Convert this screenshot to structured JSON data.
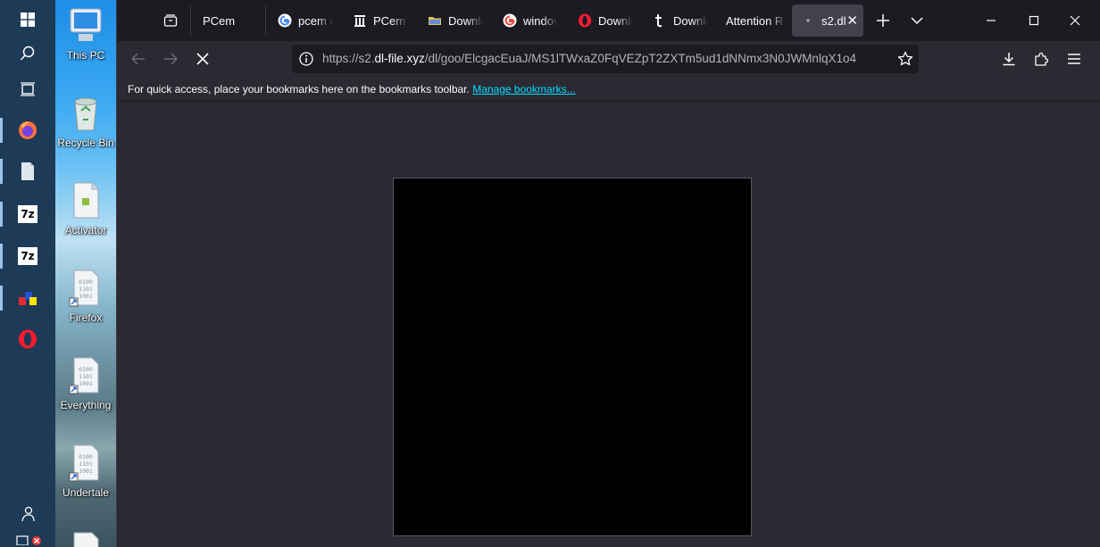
{
  "browser": {
    "tabs": [
      {
        "label": "PCem",
        "icon": "firefox-view-icon"
      },
      {
        "label": "pcem r",
        "icon": "google-icon"
      },
      {
        "label": "PCem \\",
        "icon": "library-icon"
      },
      {
        "label": "Downlc",
        "icon": "folder-icon"
      },
      {
        "label": "windov",
        "icon": "google-icon"
      },
      {
        "label": "Downlc",
        "icon": "opera-icon"
      },
      {
        "label": "Downlc",
        "icon": "t-icon"
      },
      {
        "label": "Attention R",
        "icon": ""
      },
      {
        "label": "s2.dl",
        "icon": "loading-icon",
        "selected": true
      }
    ],
    "url": {
      "prefix": "https://s2.",
      "host": "dl-file.xyz",
      "path": "/dl/goo/ElcgacEuaJ/MS1lTWxaZ0FqVEZpT2ZXTm5ud1dNNmx3N0JWMnlqX1o4"
    },
    "bookmarks_toolbar": {
      "message": "For quick access, place your bookmarks here on the bookmarks toolbar.",
      "manage_link": "Manage bookmarks..."
    }
  },
  "desktop": {
    "icons": [
      {
        "label": "This PC"
      },
      {
        "label": "Recycle Bin"
      },
      {
        "label": "Activator"
      },
      {
        "label": "Firefox"
      },
      {
        "label": "Everything"
      },
      {
        "label": "Undertale"
      }
    ]
  },
  "taskbar": {
    "seven_zip_label": "7z"
  },
  "colors": {
    "tabstrip_bg": "#1c1b22",
    "toolbar_bg": "#2b2a33",
    "selected_tab_bg": "#42414d",
    "link": "#00ddff",
    "taskbar_bg": "#1d3a57"
  }
}
